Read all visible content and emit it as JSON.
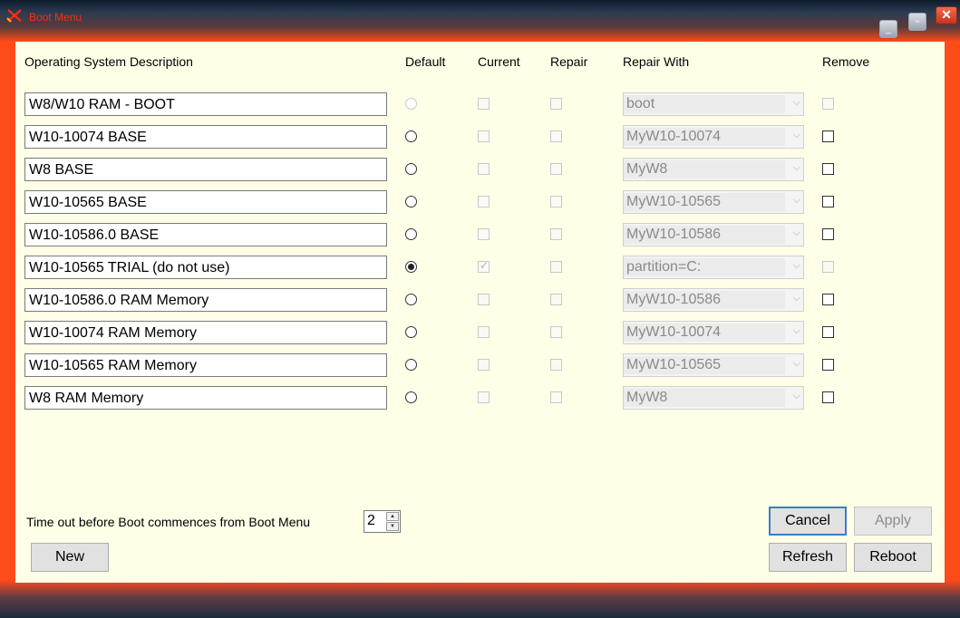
{
  "window": {
    "title": "Boot Menu",
    "minimize_label": "_",
    "maximize_label": "▫",
    "close_label": "✕"
  },
  "headers": {
    "description": "Operating System Description",
    "default": "Default",
    "current": "Current",
    "repair": "Repair",
    "repair_with": "Repair With",
    "remove": "Remove"
  },
  "rows": [
    {
      "description": "W8/W10 RAM - BOOT",
      "default_checked": false,
      "default_enabled": false,
      "current_checked": false,
      "repair_checked": false,
      "repair_with": "boot",
      "remove_checked": false,
      "remove_enabled": false
    },
    {
      "description": "W10-10074 BASE",
      "default_checked": false,
      "default_enabled": true,
      "current_checked": false,
      "repair_checked": false,
      "repair_with": "MyW10-10074",
      "remove_checked": false,
      "remove_enabled": true
    },
    {
      "description": "W8 BASE",
      "default_checked": false,
      "default_enabled": true,
      "current_checked": false,
      "repair_checked": false,
      "repair_with": "MyW8",
      "remove_checked": false,
      "remove_enabled": true
    },
    {
      "description": "W10-10565 BASE",
      "default_checked": false,
      "default_enabled": true,
      "current_checked": false,
      "repair_checked": false,
      "repair_with": "MyW10-10565",
      "remove_checked": false,
      "remove_enabled": true
    },
    {
      "description": "W10-10586.0 BASE",
      "default_checked": false,
      "default_enabled": true,
      "current_checked": false,
      "repair_checked": false,
      "repair_with": "MyW10-10586",
      "remove_checked": false,
      "remove_enabled": true
    },
    {
      "description": "W10-10565 TRIAL (do not use)",
      "default_checked": true,
      "default_enabled": true,
      "current_checked": true,
      "repair_checked": false,
      "repair_with": "partition=C:",
      "remove_checked": false,
      "remove_enabled": false
    },
    {
      "description": "W10-10586.0 RAM Memory",
      "default_checked": false,
      "default_enabled": true,
      "current_checked": false,
      "repair_checked": false,
      "repair_with": "MyW10-10586",
      "remove_checked": false,
      "remove_enabled": true
    },
    {
      "description": "W10-10074 RAM Memory",
      "default_checked": false,
      "default_enabled": true,
      "current_checked": false,
      "repair_checked": false,
      "repair_with": "MyW10-10074",
      "remove_checked": false,
      "remove_enabled": true
    },
    {
      "description": "W10-10565 RAM Memory",
      "default_checked": false,
      "default_enabled": true,
      "current_checked": false,
      "repair_checked": false,
      "repair_with": "MyW10-10565",
      "remove_checked": false,
      "remove_enabled": true
    },
    {
      "description": "W8 RAM Memory",
      "default_checked": false,
      "default_enabled": true,
      "current_checked": false,
      "repair_checked": false,
      "repair_with": "MyW8",
      "remove_checked": false,
      "remove_enabled": true
    }
  ],
  "timeout": {
    "label": "Time out before Boot commences from Boot Menu",
    "value": "2"
  },
  "buttons": {
    "new": "New",
    "cancel": "Cancel",
    "apply": "Apply",
    "refresh": "Refresh",
    "reboot": "Reboot"
  },
  "colors": {
    "frame_accent": "#ff4a1a",
    "client_background": "#ffffe8",
    "title_text": "#ff2a10"
  }
}
